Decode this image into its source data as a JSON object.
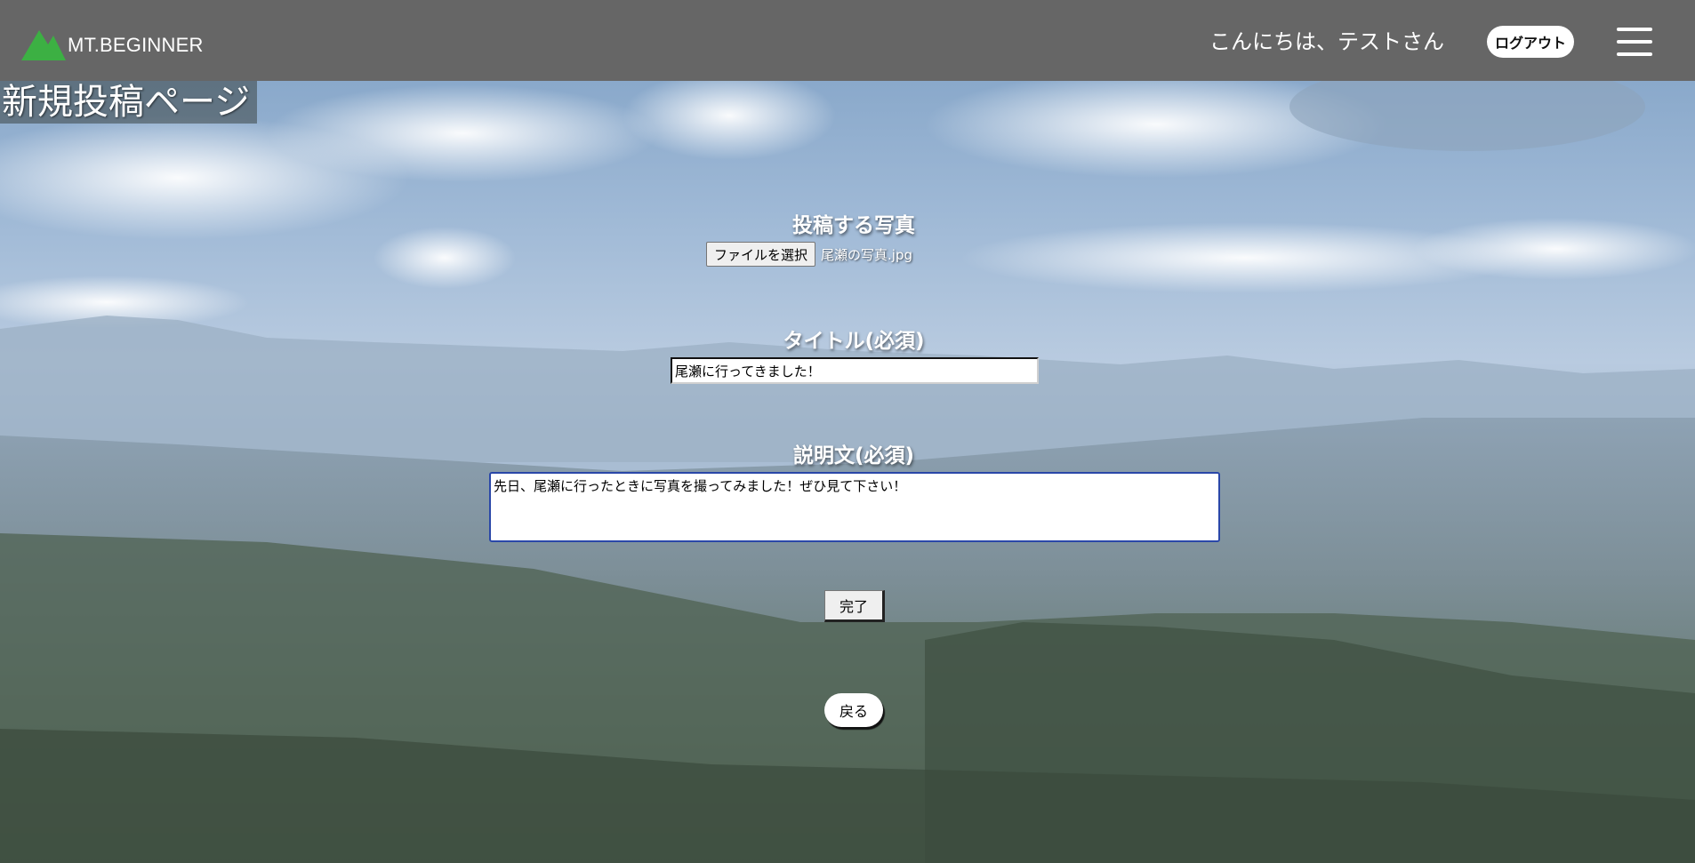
{
  "header": {
    "logo_text": "MT.BEGINNER",
    "greeting": "こんにちは、テストさん",
    "logout_label": "ログアウト"
  },
  "page": {
    "title": "新規投稿ページ"
  },
  "form": {
    "photo_label": "投稿する写真",
    "file_button_label": "ファイルを選択",
    "file_name": "尾瀬の写真.jpg",
    "title_label": "タイトル(必須)",
    "title_value": "尾瀬に行ってきました！",
    "description_label": "説明文(必須)",
    "description_value": "先日、尾瀬に行ったときに写真を撮ってみました！ぜひ見て下さい！",
    "submit_label": "完了",
    "back_label": "戻る"
  },
  "colors": {
    "header_bg": "#666666",
    "logo_green": "#3cb043",
    "desc_border": "#2a47a8"
  },
  "icons": {
    "logo": "mountain-icon",
    "menu": "hamburger-menu-icon"
  }
}
